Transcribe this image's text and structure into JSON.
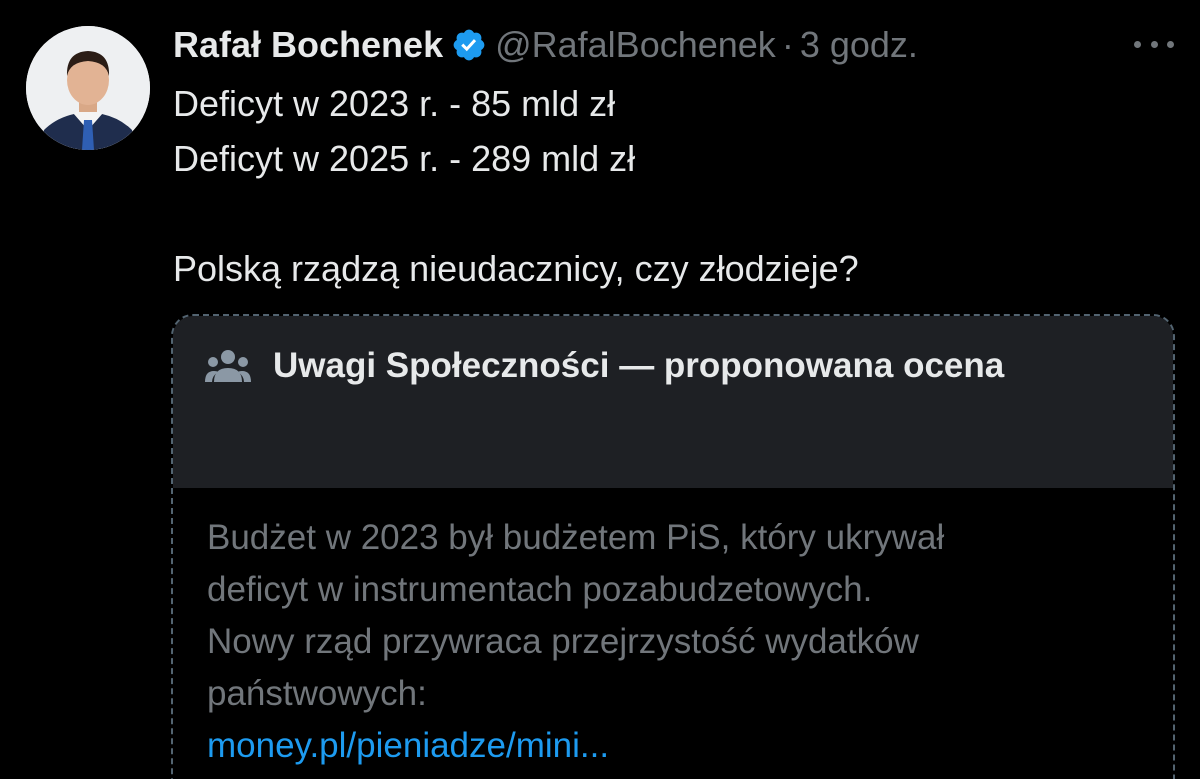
{
  "author": {
    "name": "Rafał Bochenek",
    "verified_icon": "verified-badge-icon",
    "handle": "@RafalBochenek",
    "separator": "·",
    "time": "3 godz."
  },
  "tweet": {
    "lines": [
      "Deficyt w 2023 r. - 85 mld zł",
      "Deficyt w 2025 r. - 289 mld zł",
      "",
      "Polską rządzą nieudacznicy, czy złodzieje?"
    ]
  },
  "community_note": {
    "icon": "people-icon",
    "title": "Uwagi Społeczności — proponowana ocena",
    "body_lines": [
      "Budżet w 2023 był budżetem PiS, który ukrywał",
      "deficyt w instrumentach pozabudzetowych.",
      "Nowy rząd przywraca przejrzystość wydatków",
      "państwowych:"
    ],
    "link_text": "money.pl/pieniadze/mini..."
  },
  "colors": {
    "background": "#000000",
    "primary_text": "#e7e9ea",
    "secondary_text": "#71767b",
    "link": "#1d9bf0",
    "verified": "#1d9bf0",
    "note_header_bg": "#1e2024"
  }
}
